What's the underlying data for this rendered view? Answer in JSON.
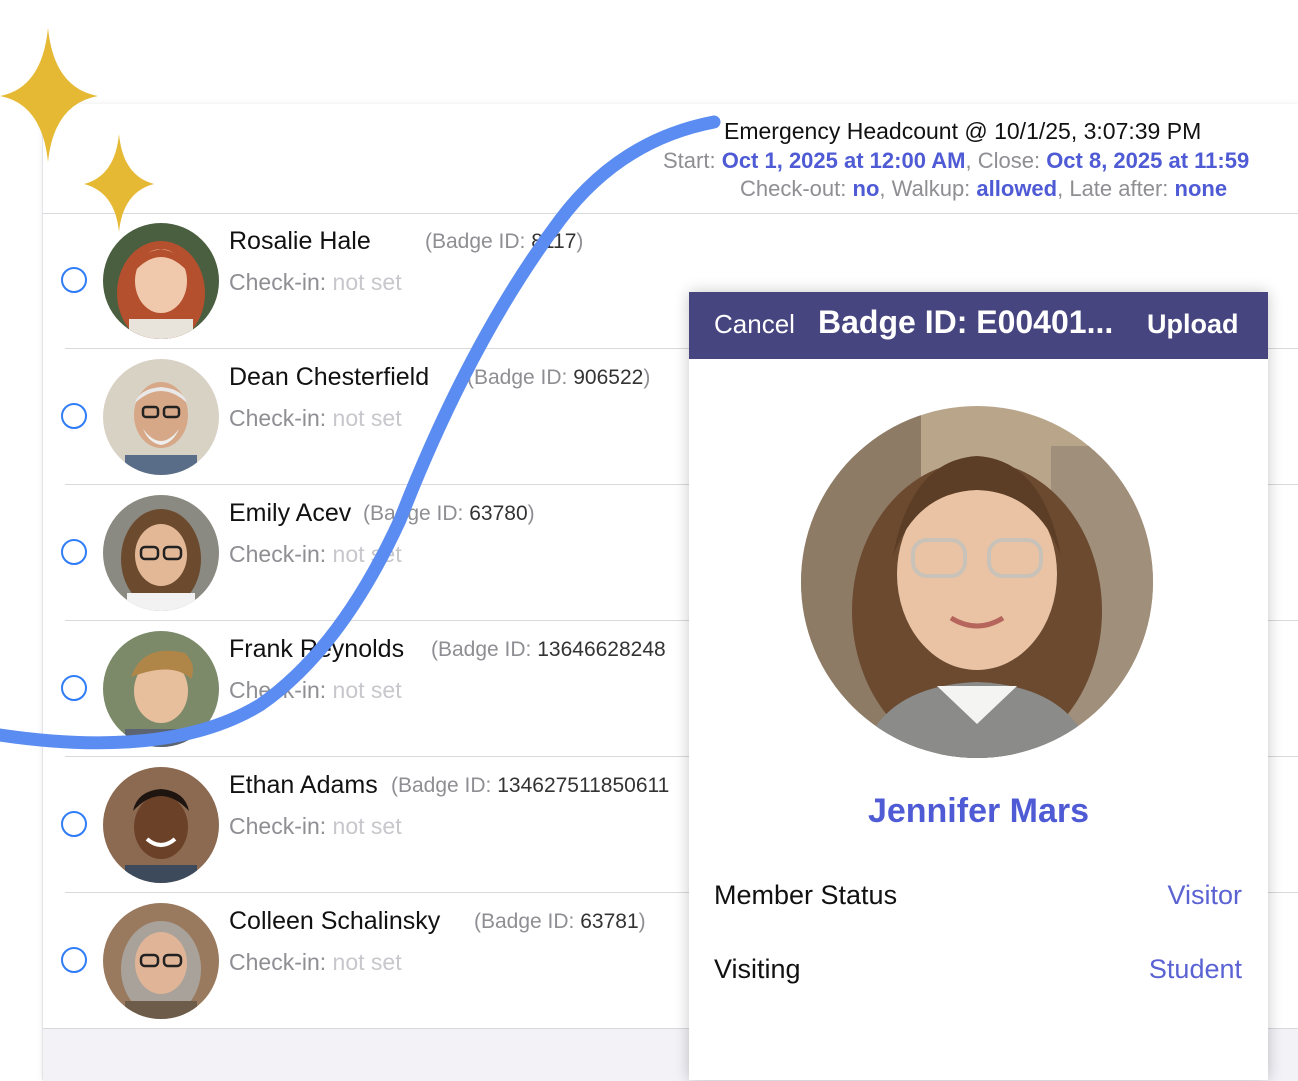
{
  "header": {
    "title": "Emergency Headcount @ 10/1/25, 3:07:39 PM",
    "start_label": "Start:",
    "start_value": "Oct 1, 2025 at 12:00 AM",
    "close_label": ", Close:",
    "close_value": "Oct 8, 2025 at 11:59",
    "checkout_label": "Check-out:",
    "checkout_value": "no",
    "walkup_label": ", Walkup:",
    "walkup_value": "allowed",
    "late_label": ", Late after:",
    "late_value": "none"
  },
  "people": [
    {
      "name": "Rosalie Hale",
      "badge_prefix": "(Badge ID:",
      "badge_id": "8117",
      "badge_suffix": ")",
      "checkin_label": "Check-in:",
      "checkin_value": "not set"
    },
    {
      "name": "Dean Chesterfield",
      "badge_prefix": "(Badge ID:",
      "badge_id": "906522",
      "badge_suffix": ")",
      "checkin_label": "Check-in:",
      "checkin_value": "not set"
    },
    {
      "name": "Emily Acev",
      "badge_prefix": "(Badge ID:",
      "badge_id": "63780",
      "badge_suffix": ")",
      "checkin_label": "Check-in:",
      "checkin_value": "not set"
    },
    {
      "name": "Frank Reynolds",
      "badge_prefix": "(Badge ID:",
      "badge_id": "13646628248",
      "badge_suffix": "",
      "checkin_label": "Check-in:",
      "checkin_value": "not set"
    },
    {
      "name": "Ethan Adams",
      "badge_prefix": "(Badge ID:",
      "badge_id": "134627511850611",
      "badge_suffix": "",
      "checkin_label": "Check-in:",
      "checkin_value": "not set"
    },
    {
      "name": "Colleen Schalinsky",
      "badge_prefix": "(Badge ID:",
      "badge_id": "63781",
      "badge_suffix": ")",
      "checkin_label": "Check-in:",
      "checkin_value": "not set"
    }
  ],
  "modal": {
    "cancel_label": "Cancel",
    "title": "Badge ID: E00401...",
    "upload_label": "Upload",
    "person_name": "Jennifer Mars",
    "fields": [
      {
        "label": "Member Status",
        "value": "Visitor"
      },
      {
        "label": "Visiting",
        "value": "Student"
      }
    ]
  },
  "colors": {
    "accent": "#4f5bd5",
    "modal_bar": "#46457f",
    "radio": "#2f7cf6",
    "sparkle": "#e6b935",
    "swoosh": "#5b8cf2"
  }
}
